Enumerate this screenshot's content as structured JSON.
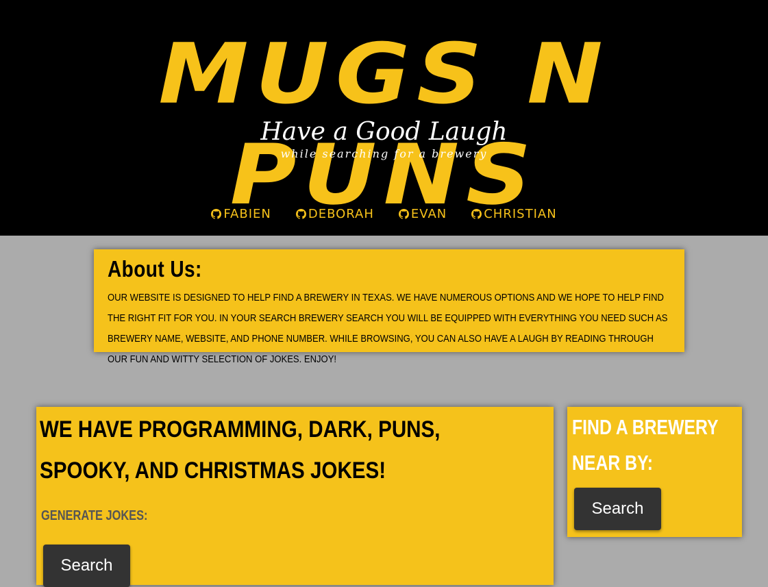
{
  "header": {
    "logo": "MUGS N PUNS",
    "tagline": "Have a Good Laugh",
    "subtagline": "while searching for a brewery"
  },
  "nav": {
    "links": [
      {
        "label": "FABIEN",
        "icon": "github-icon"
      },
      {
        "label": "DEBORAH",
        "icon": "github-icon"
      },
      {
        "label": "EVAN",
        "icon": "github-icon"
      },
      {
        "label": "CHRISTIAN",
        "icon": "github-icon"
      }
    ]
  },
  "about": {
    "title": "About Us:",
    "text": "Our website is designed to help find a brewery in Texas. We have numerous options and we hope to help find the right fit for you. In your search brewery search you will be equipped with everything you need such as brewery name, website, and phone number. While browsing, you can also have a laugh by reading through our fun and witty selection of jokes. Enjoy!"
  },
  "jokes": {
    "title": "We have Programming, Dark, Puns, Spooky, and Christmas Jokes!",
    "generate_label": "Generate Jokes:",
    "button_label": "Search"
  },
  "brewery": {
    "title": "Find a Brewery near by:",
    "button_label": "Search"
  },
  "colors": {
    "accent": "#f7c21a",
    "header_bg": "#000000",
    "page_bg": "#ababab",
    "button_bg": "#333333"
  }
}
